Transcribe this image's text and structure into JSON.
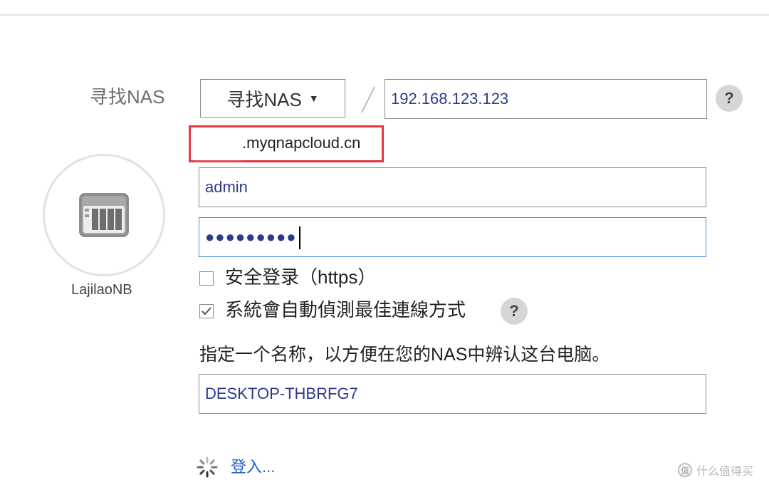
{
  "find_nas": {
    "label": "寻找NAS",
    "button_label": "寻找NAS",
    "ip_value": "192.168.123.123",
    "help_label": "?"
  },
  "cloud": {
    "address_visible": ".myqnapcloud.cn"
  },
  "device": {
    "name": "LajilaoNB",
    "icon": "nas-device-icon"
  },
  "login": {
    "username": "admin",
    "password_mask": "●●●●●●●●●"
  },
  "options": {
    "secure_login_label": "安全登录（https）",
    "secure_login_checked": false,
    "auto_detect_label": "系統會自動偵測最佳連線方式",
    "auto_detect_checked": true,
    "auto_detect_help": "?"
  },
  "pc_name": {
    "description": "指定一个名称，以方便在您的NAS中辨认这台电脑。",
    "value": "DESKTOP-THBRFG7"
  },
  "status": {
    "login_text": "登入..."
  },
  "watermark": {
    "icon_text": "值",
    "text": "什么值得买"
  },
  "colors": {
    "highlight_box": "#e8323a",
    "focus_border": "#3d8fd6",
    "link": "#1f5bd6",
    "input_text": "#2b3a8c"
  }
}
